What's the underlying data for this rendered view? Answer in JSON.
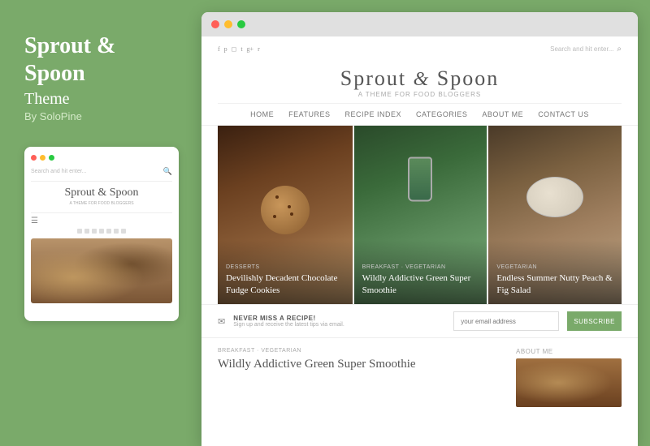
{
  "left": {
    "title": "Sprout &",
    "title2": "Spoon",
    "subtitle": "Theme",
    "by": "By SoloPine"
  },
  "mobile": {
    "search_placeholder": "Search and hit enter...",
    "logo": "Sprout & Spoon",
    "tagline": "A THEME FOR FOOD BLOGGERS"
  },
  "browser": {
    "dots": [
      "red",
      "yellow",
      "green"
    ]
  },
  "site": {
    "search_label": "Search and hit enter...",
    "logo_main": "Sprout & Spoon",
    "logo_tagline": "A THEME FOR FOOD BLOGGERS",
    "nav": [
      "HOME",
      "FEATURES",
      "RECIPE INDEX",
      "CATEGORIES",
      "ABOUT ME",
      "CONTACT US"
    ]
  },
  "cards": [
    {
      "category": "DESSERTS",
      "title": "Devilishly Decadent Chocolate Fudge Cookies"
    },
    {
      "category": "BREAKFAST · VEGETARIAN",
      "title": "Wildly Addictive Green Super Smoothie"
    },
    {
      "category": "VEGETARIAN",
      "title": "Endless Summer Nutty Peach & Fig Salad"
    }
  ],
  "newsletter": {
    "title": "NEVER MISS A RECIPE!",
    "subtitle": "Sign up and receive the latest tips via email.",
    "input_placeholder": "your email address",
    "button_label": "SUBSCRIBE"
  },
  "post": {
    "category": "BREAKFAST · VEGETARIAN",
    "title": "Wildly Addictive Green Super Smoothie"
  },
  "sidebar": {
    "about_label": "ABOUT ME"
  }
}
